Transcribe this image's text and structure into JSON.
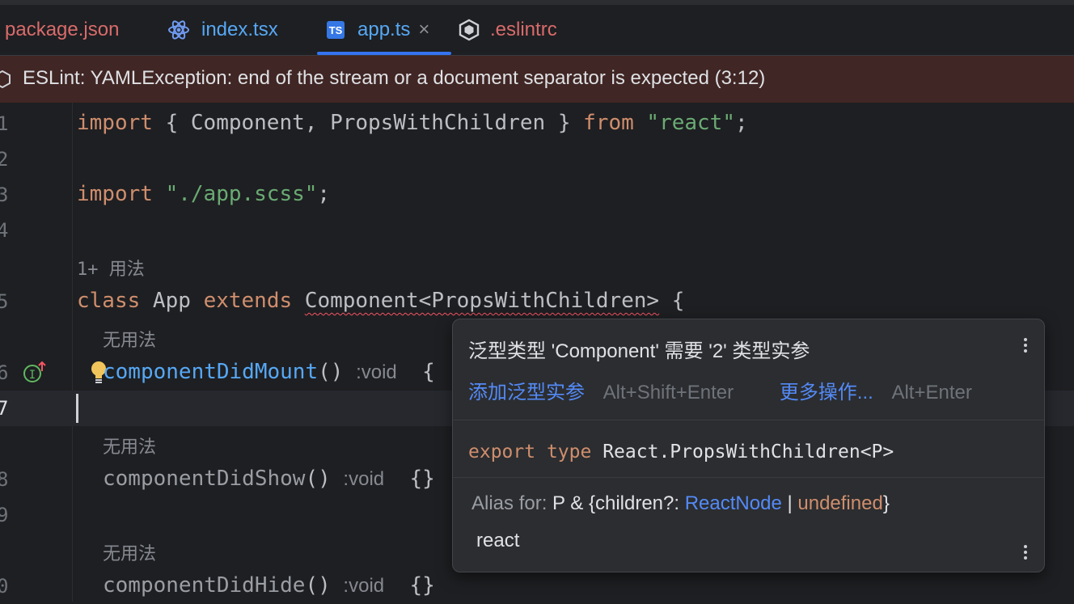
{
  "tabs": [
    {
      "label": "package.json",
      "color": "#d96b6b"
    },
    {
      "label": "index.tsx",
      "color": "#56a8f5"
    },
    {
      "label": "app.ts",
      "color": "#56a8f5",
      "active": true,
      "icon_text": "TS"
    },
    {
      "label": ".eslintrc",
      "color": "#d96b6b"
    }
  ],
  "banner": {
    "text": "ESLint: YAMLException: end of the stream or a document separator is expected (3:12)"
  },
  "editor": {
    "line_numbers": [
      "1",
      "2",
      "3",
      "4",
      "5",
      "6",
      "7",
      "8",
      "9",
      "0"
    ],
    "line1": {
      "kw1": "import",
      "p1": " { Component, PropsWithChildren } ",
      "kw2": "from",
      "str": " \"react\"",
      "end": ";"
    },
    "line3": {
      "kw": "import",
      "str": " \"./app.scss\"",
      "end": ";"
    },
    "usage_hint_1": "1+ 用法",
    "line5": {
      "kw1": "class",
      "p1": " App ",
      "kw2": "extends",
      "sp": " ",
      "type": "Component<PropsWithChildren>",
      "end": " {"
    },
    "no_usage_hint": "无用法",
    "line6": {
      "method": "componentDidMount",
      "parens": "()",
      "void": ":void",
      "brace": "{"
    },
    "line8": {
      "method": "componentDidShow",
      "parens": "()",
      "void": ":void",
      "brace": "{}"
    },
    "line10": {
      "method": "componentDidHide",
      "parens": "()",
      "void": ":void",
      "brace": "{}"
    }
  },
  "popup": {
    "title": "泛型类型 'Component' 需要 '2' 类型实参",
    "action1": "添加泛型实参",
    "action1_shortcut": "Alt+Shift+Enter",
    "action2": "更多操作...",
    "action2_shortcut": "Alt+Enter",
    "code": {
      "kw1": "export",
      "kw2": "type",
      "rest": "React.PropsWithChildren<P>"
    },
    "alias_label": "Alias for:",
    "alias_text": "P & {children?:",
    "alias_link": "ReactNode",
    "alias_pipe": "|",
    "alias_undef": "undefined",
    "alias_end": "}",
    "module": "react"
  },
  "colors": {
    "background": "#1e1f22",
    "banner": "#402624",
    "accent": "#3574f0",
    "keyword": "#cf8e6d",
    "string": "#6aab73",
    "function": "#56a8f5",
    "error": "#f75464"
  }
}
